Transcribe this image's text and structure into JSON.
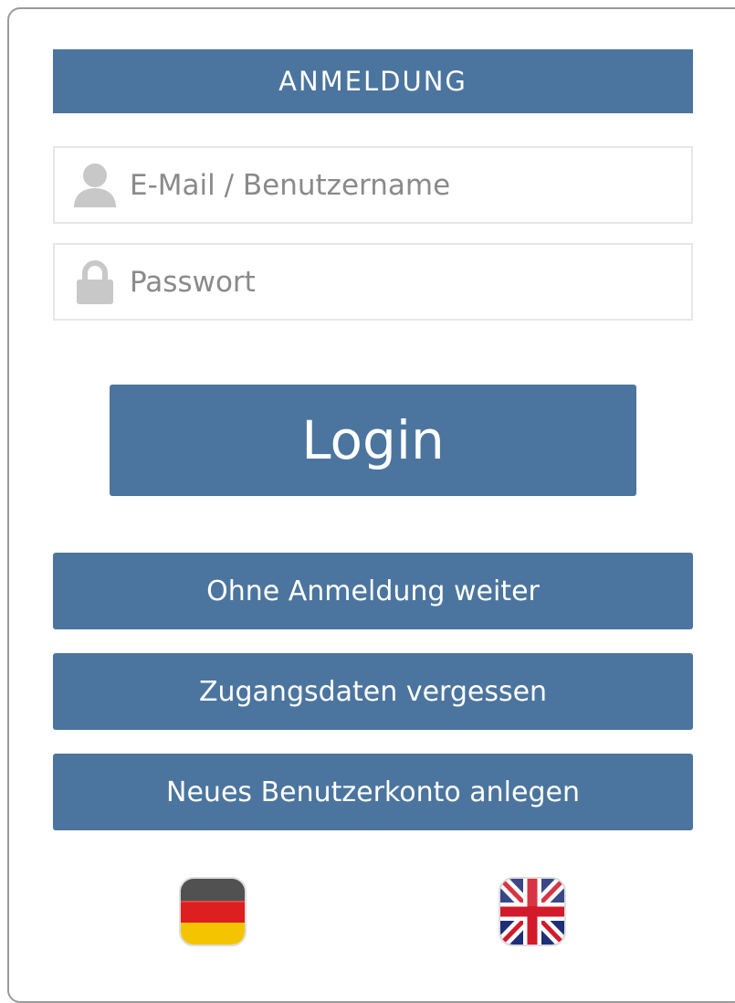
{
  "login_form": {
    "title": "ANMELDUNG",
    "email": {
      "value": "",
      "placeholder": "E-Mail / Benutzername",
      "icon": "user-icon"
    },
    "password": {
      "value": "",
      "placeholder": "Passwort",
      "icon": "lock-icon"
    },
    "login_label": "Login",
    "guest_label": "Ohne Anmeldung weiter",
    "forgot_label": "Zugangsdaten vergessen",
    "register_label": "Neues Benutzerkonto anlegen"
  },
  "languages": [
    {
      "code": "de",
      "icon": "german-flag-icon"
    },
    {
      "code": "en",
      "icon": "uk-flag-icon"
    }
  ],
  "colors": {
    "accent": "#4b759e",
    "icon_gray": "#c8c8c8",
    "border": "#e6e6e6"
  }
}
